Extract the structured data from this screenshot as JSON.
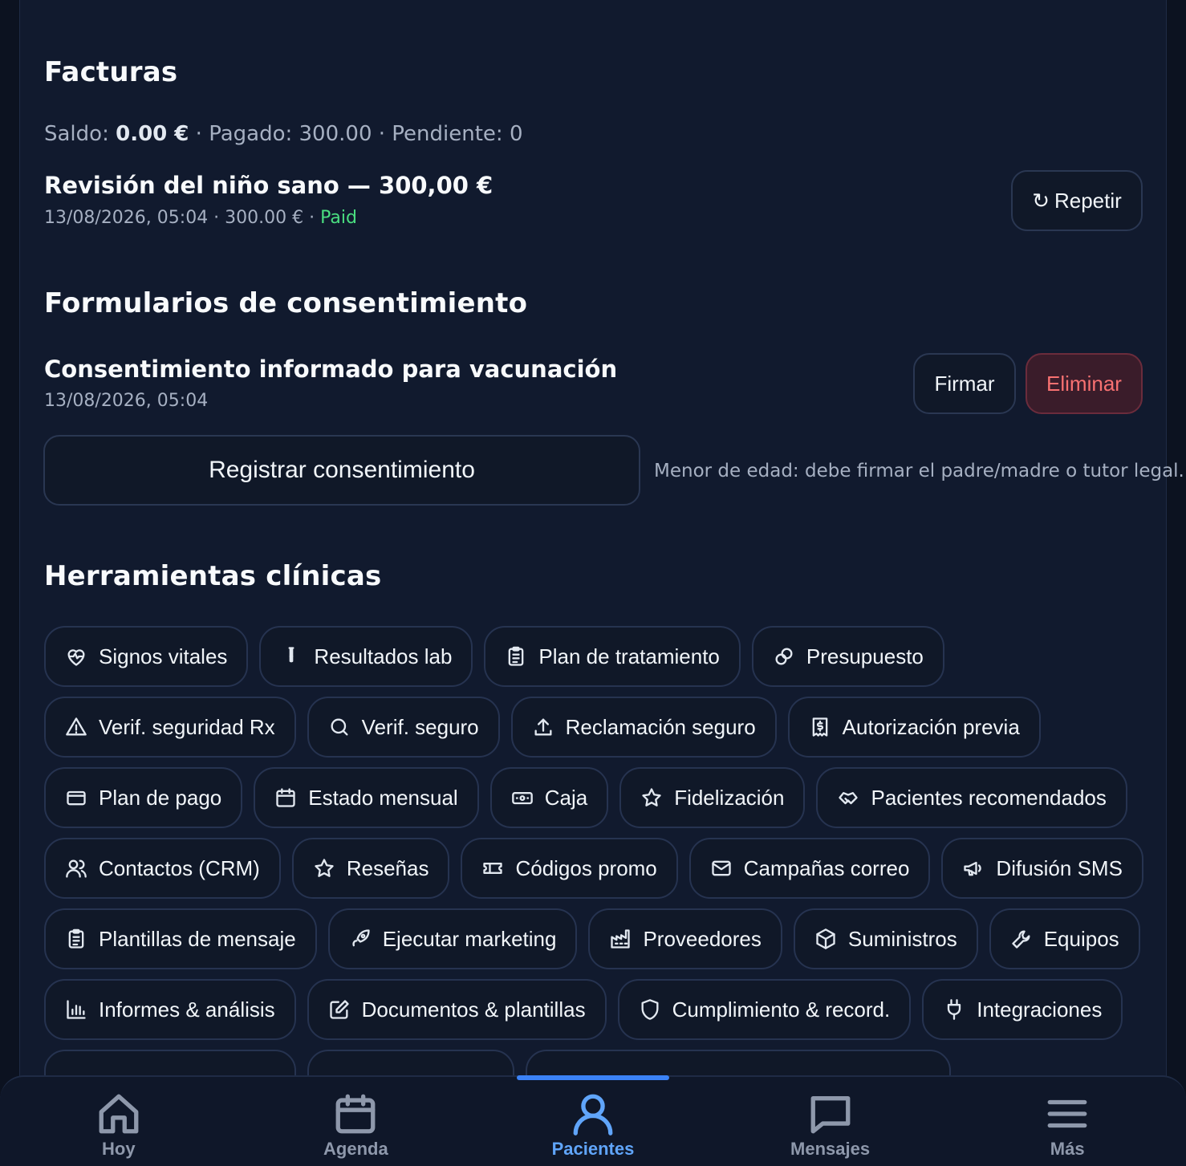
{
  "invoices": {
    "title": "Facturas",
    "summary": {
      "balance_label": "Saldo:",
      "balance_value": "0.00 €",
      "paid_text": "· Pagado: 300.00",
      "pending_text": "· Pendiente: 0"
    },
    "item": {
      "title": "Revisión del niño sano — 300,00 €",
      "meta": "13/08/2026, 05:04 · 300.00 € ·",
      "status": "Paid",
      "repeat_label": "Repetir"
    }
  },
  "consent": {
    "title": "Formularios de consentimiento",
    "item": {
      "title": "Consentimiento informado para vacunación",
      "date": "13/08/2026, 05:04",
      "sign_label": "Firmar",
      "delete_label": "Eliminar"
    },
    "register_label": "Registrar consentimiento",
    "minor_note": "Menor de edad: debe firmar el padre/madre o tutor legal."
  },
  "tools": {
    "title": "Herramientas clínicas",
    "rows": [
      [
        {
          "label": "Signos vitales",
          "icon": "heart-pulse-icon"
        },
        {
          "label": "Resultados lab",
          "icon": "test-tube-icon"
        },
        {
          "label": "Plan de tratamiento",
          "icon": "clipboard-list-icon"
        },
        {
          "label": "Presupuesto",
          "icon": "coins-icon"
        }
      ],
      [
        {
          "label": "Verif. seguridad Rx",
          "icon": "warning-triangle-icon"
        },
        {
          "label": "Verif. seguro",
          "icon": "search-icon"
        },
        {
          "label": "Reclamación seguro",
          "icon": "upload-icon"
        },
        {
          "label": "Autorización previa",
          "icon": "receipt-icon"
        }
      ],
      [
        {
          "label": "Plan de pago",
          "icon": "credit-card-icon"
        },
        {
          "label": "Estado mensual",
          "icon": "calendar-icon"
        },
        {
          "label": "Caja",
          "icon": "cash-icon"
        },
        {
          "label": "Fidelización",
          "icon": "star-icon"
        },
        {
          "label": "Pacientes recomendados",
          "icon": "handshake-icon"
        }
      ],
      [
        {
          "label": "Contactos (CRM)",
          "icon": "users-icon"
        },
        {
          "label": "Reseñas",
          "icon": "star-icon"
        },
        {
          "label": "Códigos promo",
          "icon": "ticket-icon"
        },
        {
          "label": "Campañas correo",
          "icon": "mail-icon"
        },
        {
          "label": "Difusión SMS",
          "icon": "megaphone-icon"
        }
      ],
      [
        {
          "label": "Plantillas de mensaje",
          "icon": "clipboard-list-icon"
        },
        {
          "label": "Ejecutar marketing",
          "icon": "rocket-icon"
        },
        {
          "label": "Proveedores",
          "icon": "factory-icon"
        },
        {
          "label": "Suministros",
          "icon": "package-icon"
        },
        {
          "label": "Equipos",
          "icon": "wrench-icon"
        }
      ],
      [
        {
          "label": "Informes & análisis",
          "icon": "bar-chart-icon"
        },
        {
          "label": "Documentos & plantillas",
          "icon": "edit-icon"
        },
        {
          "label": "Cumplimiento & record.",
          "icon": "shield-icon"
        },
        {
          "label": "Integraciones",
          "icon": "plug-icon"
        }
      ]
    ]
  },
  "nav": {
    "items": [
      {
        "label": "Hoy",
        "icon": "home-icon"
      },
      {
        "label": "Agenda",
        "icon": "calendar-icon"
      },
      {
        "label": "Pacientes",
        "icon": "user-icon",
        "active": true
      },
      {
        "label": "Mensajes",
        "icon": "message-icon"
      },
      {
        "label": "Más",
        "icon": "menu-icon"
      }
    ]
  },
  "colors": {
    "background": "#111a2e",
    "accent": "#3b82f6",
    "paid": "#4ade80",
    "danger": "#f87171"
  }
}
